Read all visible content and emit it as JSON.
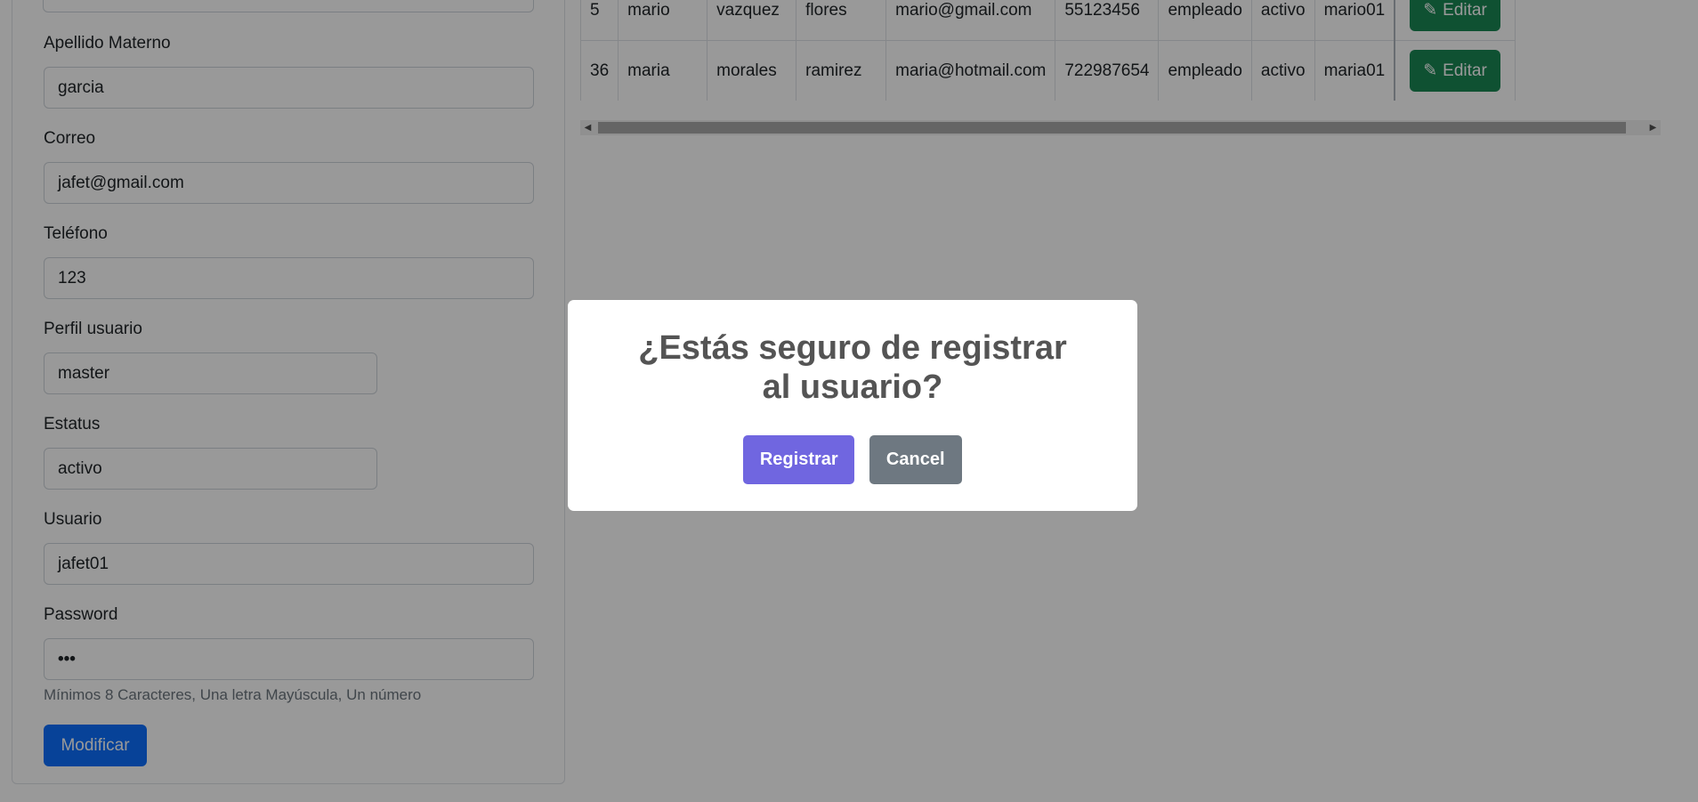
{
  "form": {
    "fields": [
      {
        "label": "Apellido Materno",
        "value": "garcia"
      },
      {
        "label": "Correo",
        "value": "jafet@gmail.com"
      },
      {
        "label": "Teléfono",
        "value": "123"
      },
      {
        "label": "Perfil usuario",
        "value": "master"
      },
      {
        "label": "Estatus",
        "value": "activo"
      },
      {
        "label": "Usuario",
        "value": "jafet01"
      },
      {
        "label": "Password",
        "value": "•••"
      }
    ],
    "password_hint": "Mínimos 8 Caracteres, Una letra Mayúscula, Un número",
    "submit_label": "Modificar"
  },
  "table": {
    "rows": [
      [
        "5",
        "mario",
        "vazquez",
        "flores",
        "mario@gmail.com",
        "55123456",
        "empleado",
        "activo",
        "mario01"
      ],
      [
        "36",
        "maria",
        "morales",
        "ramirez",
        "maria@hotmail.com",
        "722987654",
        "empleado",
        "activo",
        "maria01"
      ]
    ],
    "edit_label": "Editar"
  },
  "modal": {
    "title": "¿Estás seguro de registrar al usuario?",
    "confirm_label": "Registrar",
    "cancel_label": "Cancel"
  }
}
